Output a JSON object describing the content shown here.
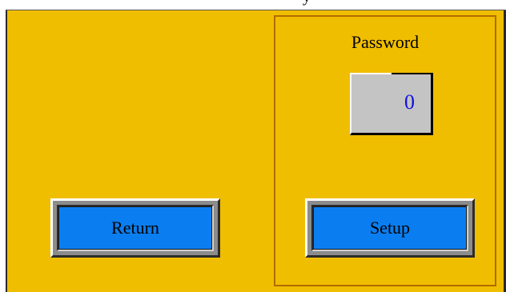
{
  "header": {
    "title_fragment": "y"
  },
  "password_panel": {
    "label": "Password",
    "value": "0"
  },
  "buttons": {
    "return_label": "Return",
    "setup_label": "Setup"
  },
  "colors": {
    "background": "#f0be00",
    "button_face": "#0a7ef0",
    "panel_border": "#b36b00",
    "value_text": "#1010e0",
    "field_bg": "#c4c4c4"
  }
}
